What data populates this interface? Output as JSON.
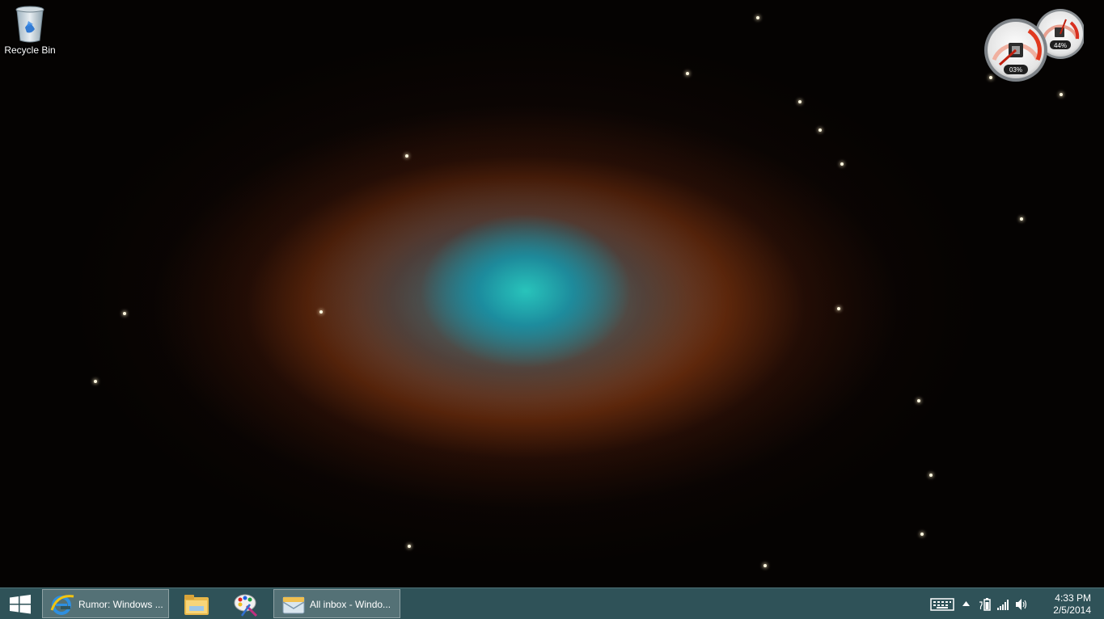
{
  "desktop": {
    "icons": [
      {
        "label": "Recycle Bin",
        "icon": "recycle-bin-icon"
      }
    ]
  },
  "gadget": {
    "cpu_label": "03%",
    "memory_label": "44%",
    "cpu_percent": 3,
    "memory_percent": 44
  },
  "taskbar": {
    "start_icon": "windows-logo-icon",
    "items": [
      {
        "label": "Rumor: Windows ...",
        "icon": "internet-explorer-icon",
        "active": true
      },
      {
        "label": "",
        "icon": "file-explorer-icon",
        "active": false
      },
      {
        "label": "",
        "icon": "paint-icon",
        "active": false
      },
      {
        "label": "All inbox - Windo...",
        "icon": "mail-icon",
        "active": true
      }
    ],
    "tray": {
      "icons": [
        "touch-keyboard-icon",
        "show-hidden-icons-icon",
        "battery-icon",
        "network-signal-icon",
        "volume-icon"
      ],
      "time": "4:33 PM",
      "date": "2/5/2014"
    }
  },
  "colors": {
    "taskbar": "#2f5258",
    "window_button": "#5a7c80"
  }
}
